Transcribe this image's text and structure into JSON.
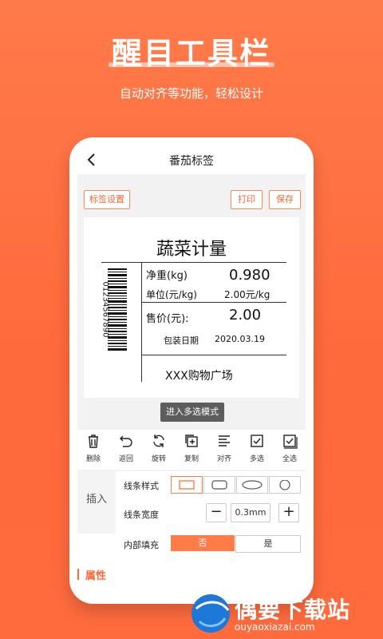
{
  "hero": {
    "title": "醒目工具栏",
    "subtitle": "自动对齐等功能，轻松设计"
  },
  "app": {
    "nav_title": "番茄标签",
    "buttons": {
      "label_settings": "标签设置",
      "print": "打印",
      "save": "保存"
    },
    "label": {
      "title": "蔬菜计量",
      "barcode_number": "01234567890",
      "rows": [
        {
          "key": "净重(kg)",
          "value": "0.980"
        },
        {
          "key": "单位(元/kg)",
          "value": "2.00元/kg"
        },
        {
          "key": "售价(元):",
          "value": "2.00"
        },
        {
          "key": "包装日期",
          "value": "2020.03.19"
        }
      ],
      "store": "XXX购物广场"
    },
    "multi_select_button": "进入多选模式",
    "toolbar": [
      {
        "label": "删除",
        "icon": "trash-icon"
      },
      {
        "label": "返回",
        "icon": "undo-icon"
      },
      {
        "label": "旋转",
        "icon": "rotate-icon"
      },
      {
        "label": "复制",
        "icon": "copy-icon"
      },
      {
        "label": "对齐",
        "icon": "align-icon"
      },
      {
        "label": "多选",
        "icon": "checkbox-icon"
      },
      {
        "label": "全选",
        "icon": "select-all-icon"
      }
    ],
    "panel": {
      "insert_tab": "插入",
      "line_style_label": "线条样式",
      "line_width_label": "线条宽度",
      "line_width_value": "0.3mm",
      "fill_label": "内部填充",
      "fill_options": [
        "否",
        "是"
      ],
      "fill_selected": "否",
      "properties_tab": "属性"
    }
  },
  "watermark": {
    "text": "偶要下载站",
    "url": "ouyaoxiazai.com"
  },
  "colors": {
    "background": "#ff6b3d",
    "accent": "#ff7b48"
  }
}
